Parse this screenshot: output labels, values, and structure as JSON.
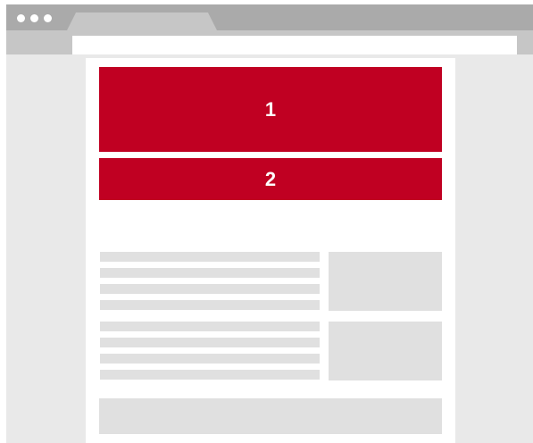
{
  "browser": {
    "window_controls": [
      "dot-icon",
      "dot-icon",
      "dot-icon"
    ],
    "active_tab_label": "",
    "address_bar_value": ""
  },
  "page": {
    "blocks": [
      {
        "label": "1",
        "color": "#c00022"
      },
      {
        "label": "2",
        "color": "#c00022"
      }
    ],
    "content_rows": [
      {
        "lines": 4,
        "thumbnail": "image-placeholder"
      },
      {
        "lines": 4,
        "thumbnail": "image-placeholder"
      }
    ],
    "footer": "placeholder"
  },
  "colors": {
    "accent": "#c00022",
    "placeholder": "#e0e0e0",
    "chrome": "#aaaaaa",
    "toolbar": "#c6c6c6",
    "window_background": "#e9e9e9"
  }
}
